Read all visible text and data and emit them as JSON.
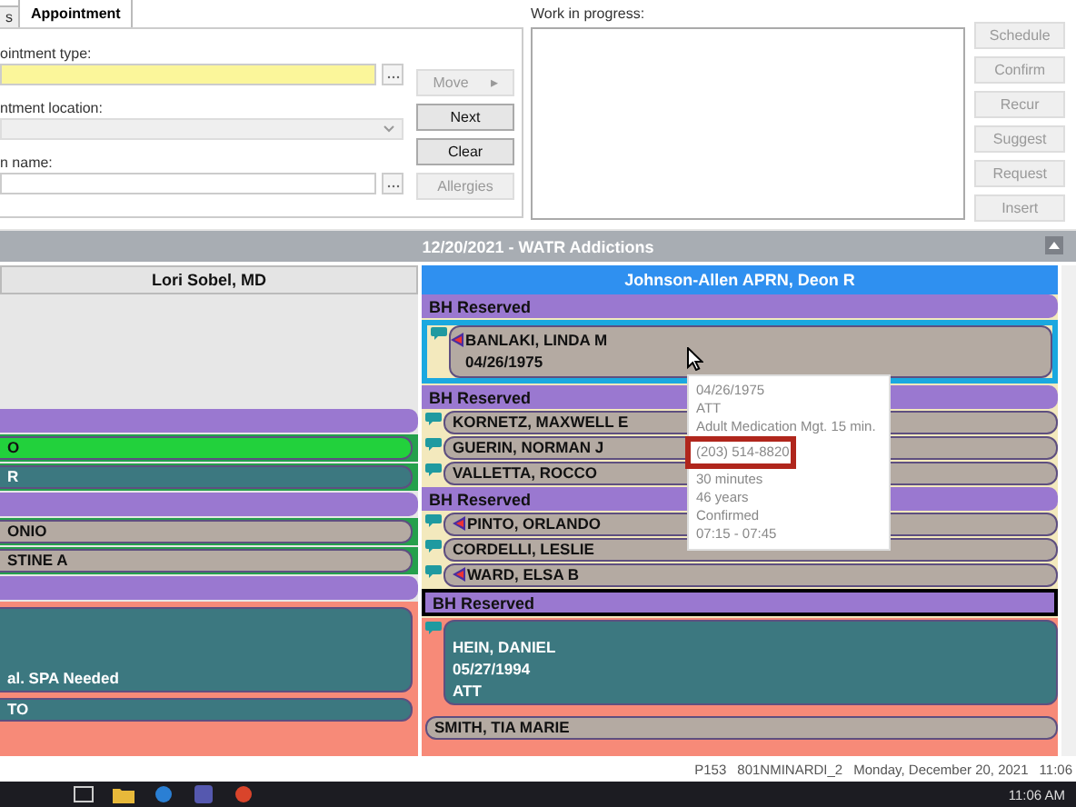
{
  "tabs": [
    {
      "label": "s",
      "selected": false
    },
    {
      "label": "Appointment",
      "selected": true
    }
  ],
  "form": {
    "fields": [
      {
        "label": "ointment type:",
        "kind": "browse",
        "highlighted": true
      },
      {
        "label": "ntment location:",
        "kind": "dropdown",
        "highlighted": false
      },
      {
        "label": "n name:",
        "kind": "browse",
        "highlighted": false
      }
    ],
    "buttons": [
      {
        "label": "Move",
        "disabled": true,
        "arrow": "▸"
      },
      {
        "label": "Next",
        "disabled": false
      },
      {
        "label": "Clear",
        "disabled": false
      },
      {
        "label": "Allergies",
        "disabled": true
      }
    ]
  },
  "work_in_progress": {
    "label": "Work in progress:",
    "buttons": [
      {
        "label": "Schedule",
        "disabled": true
      },
      {
        "label": "Confirm",
        "disabled": true
      },
      {
        "label": "Recur",
        "disabled": true
      },
      {
        "label": "Suggest",
        "disabled": true
      },
      {
        "label": "Request",
        "disabled": true
      },
      {
        "label": "Insert",
        "disabled": true
      }
    ]
  },
  "schedule": {
    "title": "12/20/2021 - WATR Addictions",
    "columns": [
      {
        "provider": "Lori Sobel, MD",
        "selected": false,
        "slots": [
          {
            "kind": "empty"
          },
          {
            "kind": "reserved",
            "selected": false
          },
          {
            "kind": "appointment",
            "lines": [
              "O"
            ],
            "color": "#22d13c",
            "selected": false
          },
          {
            "kind": "appointment",
            "lines": [
              "R"
            ],
            "color": "#3c7880",
            "selected": false
          },
          {
            "kind": "reserved",
            "selected": false
          },
          {
            "kind": "appointment",
            "lines": [
              "ONIO"
            ],
            "color": "#b4aaa2",
            "selected": false
          },
          {
            "kind": "appointment",
            "lines": [
              "STINE A"
            ],
            "color": "#b4aaa2",
            "selected": false
          },
          {
            "kind": "reserved",
            "selected": false
          },
          {
            "kind": "area",
            "children": [
              {
                "kind": "appointment",
                "lines": [
                  "al. SPA Needed"
                ],
                "color": "#3c7880",
                "selected": false
              },
              {
                "kind": "appointment",
                "lines": [
                  "TO"
                ],
                "color": "#3c7880",
                "selected": false
              }
            ]
          }
        ]
      },
      {
        "provider": "Johnson-Allen APRN, Deon R",
        "selected": true,
        "slots": [
          {
            "kind": "reserved",
            "label": "BH Reserved",
            "selected": false
          },
          {
            "kind": "appointment",
            "lines": [
              "BANLAKI, LINDA M",
              "04/26/1975"
            ],
            "color": "#b4aaa2",
            "note": true,
            "flag": true,
            "selected": true
          },
          {
            "kind": "reserved",
            "label": "BH Reserved",
            "selected": false
          },
          {
            "kind": "appointment",
            "lines": [
              "KORNETZ, MAXWELL E"
            ],
            "color": "#b4aaa2",
            "note": true,
            "flag": false,
            "selected": false
          },
          {
            "kind": "appointment",
            "lines": [
              "GUERIN, NORMAN J"
            ],
            "color": "#b4aaa2",
            "note": true,
            "flag": false,
            "selected": false
          },
          {
            "kind": "appointment",
            "lines": [
              "VALLETTA, ROCCO"
            ],
            "color": "#b4aaa2",
            "note": true,
            "flag": false,
            "selected": false
          },
          {
            "kind": "reserved",
            "label": "BH Reserved",
            "selected": false
          },
          {
            "kind": "appointment",
            "lines": [
              "PINTO, ORLANDO"
            ],
            "color": "#b4aaa2",
            "note": true,
            "flag": true,
            "selected": false
          },
          {
            "kind": "appointment",
            "lines": [
              "CORDELLI, LESLIE"
            ],
            "color": "#b4aaa2",
            "note": true,
            "flag": false,
            "selected": false
          },
          {
            "kind": "appointment",
            "lines": [
              "WARD, ELSA B"
            ],
            "color": "#b4aaa2",
            "note": true,
            "flag": true,
            "selected": false
          },
          {
            "kind": "reserved",
            "label": "BH Reserved",
            "selected": true
          },
          {
            "kind": "area",
            "children": [
              {
                "kind": "appointment",
                "lines": [
                  "HEIN, DANIEL",
                  "05/27/1994",
                  "ATT"
                ],
                "color": "#3c7880",
                "note": true,
                "flag": false,
                "selected": false
              },
              {
                "kind": "appointment",
                "lines": [
                  "SMITH, TIA MARIE"
                ],
                "color": "#b4aaa2",
                "note": false,
                "flag": false,
                "selected": false
              }
            ]
          }
        ]
      }
    ]
  },
  "tooltip": {
    "lines": [
      "04/26/1975",
      "ATT",
      "Adult Medication Mgt. 15 min."
    ],
    "highlighted": "(203) 514-8820",
    "lines_after": [
      "30 minutes",
      "46 years",
      "Confirmed",
      "07:15 - 07:45"
    ]
  },
  "status_bar": [
    "P153",
    "801NMINARDI_2",
    "Monday, December 20, 2021",
    "11:06"
  ],
  "taskbar": {
    "clock": "11:06 AM"
  }
}
